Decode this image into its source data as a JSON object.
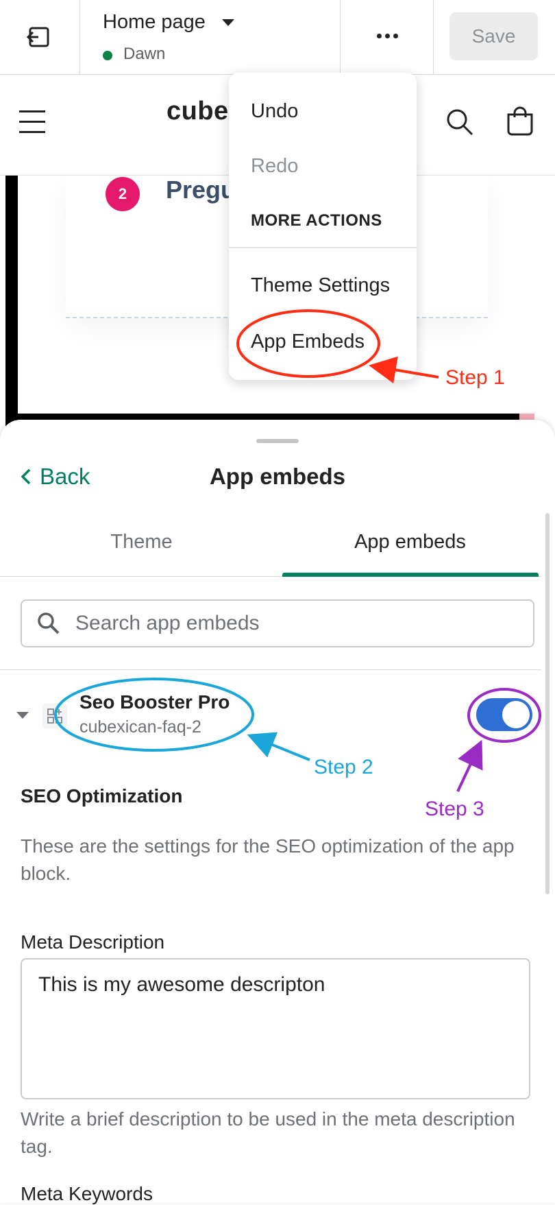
{
  "editor": {
    "page_title": "Home page",
    "theme_name": "Dawn",
    "save_label": "Save",
    "theme_status_color": "#108043"
  },
  "store": {
    "logo": "cube",
    "faq_number": "2",
    "faq_text": "Pregu"
  },
  "menu": {
    "undo": "Undo",
    "redo": "Redo",
    "heading": "MORE ACTIONS",
    "theme_settings": "Theme Settings",
    "app_embeds": "App Embeds"
  },
  "sheet": {
    "back_label": "Back",
    "title": "App embeds",
    "tabs": [
      {
        "label": "Theme",
        "active": false
      },
      {
        "label": "App embeds",
        "active": true
      }
    ],
    "search_placeholder": "Search app embeds",
    "embed": {
      "name": "Seo Booster Pro",
      "handle": "cubexican-faq-2",
      "enabled": true
    },
    "settings": {
      "heading": "SEO Optimization",
      "description": "These are the settings for the SEO optimization of the app block.",
      "meta_description_label": "Meta Description",
      "meta_description_value": "This is my awesome descripton",
      "meta_description_help": "Write a brief description to be used in the meta description tag.",
      "meta_keywords_label": "Meta Keywords"
    }
  },
  "annotations": {
    "step1": "Step 1",
    "step2": "Step 2",
    "step3": "Step 3",
    "step1_color": "#ff2d14",
    "step2_color": "#1aa6d9",
    "step3_color": "#9a2bc4"
  },
  "colors": {
    "accent": "#008060",
    "toggle_on": "#2d6fd2",
    "faq_badge": "#e4196b"
  }
}
